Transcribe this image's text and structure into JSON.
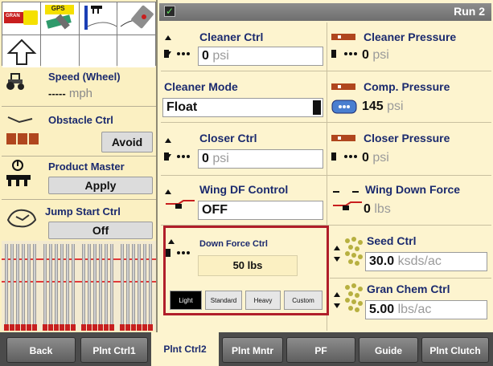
{
  "topbar": {
    "run_label": "Run 2"
  },
  "icons": {
    "gran_label": "GRAN",
    "gps_label": "GPS"
  },
  "left": {
    "speed": {
      "title": "Speed (Wheel)",
      "value": "-----",
      "unit": "mph"
    },
    "obstacle": {
      "title": "Obstacle Ctrl",
      "button": "Avoid"
    },
    "product_master": {
      "title": "Product Master",
      "button": "Apply"
    },
    "jump_start": {
      "title": "Jump Start Ctrl",
      "button": "Off"
    }
  },
  "main": {
    "cleaner_ctrl": {
      "title": "Cleaner Ctrl",
      "value": "0",
      "unit": "psi"
    },
    "cleaner_pressure": {
      "title": "Cleaner Pressure",
      "value": "0",
      "unit": "psi"
    },
    "cleaner_mode": {
      "title": "Cleaner Mode",
      "value": "Float"
    },
    "comp_pressure": {
      "title": "Comp. Pressure",
      "value": "145",
      "unit": "psi"
    },
    "closer_ctrl": {
      "title": "Closer Ctrl",
      "value": "0",
      "unit": "psi"
    },
    "closer_pressure": {
      "title": "Closer Pressure",
      "value": "0",
      "unit": "psi"
    },
    "wing_df_control": {
      "title": "Wing DF Control",
      "value": "OFF"
    },
    "wing_down_force": {
      "title": "Wing Down Force",
      "value": "0",
      "unit": "lbs"
    },
    "down_force_ctrl": {
      "title": "Down Force Ctrl",
      "value": "50 lbs",
      "options": [
        "Light",
        "Standard",
        "Heavy",
        "Custom"
      ],
      "selected": "Light"
    },
    "seed_ctrl": {
      "title": "Seed Ctrl",
      "value": "30.0",
      "unit": "ksds/ac"
    },
    "gran_chem_ctrl": {
      "title": "Gran Chem Ctrl",
      "value": "5.00",
      "unit": "lbs/ac"
    }
  },
  "tabs": [
    {
      "label": "Back"
    },
    {
      "label": "Plnt Ctrl1"
    },
    {
      "label": "Plnt Ctrl2"
    },
    {
      "label": "Plnt Mntr"
    },
    {
      "label": "PF"
    },
    {
      "label": "Guide"
    },
    {
      "label": "Plnt Clutch"
    }
  ],
  "colors": {
    "panel_bg": "#fdf4cf",
    "title_blue": "#1b2a6e",
    "highlight_red": "#b01e2a",
    "tab_gray": "#6e6e6e"
  }
}
